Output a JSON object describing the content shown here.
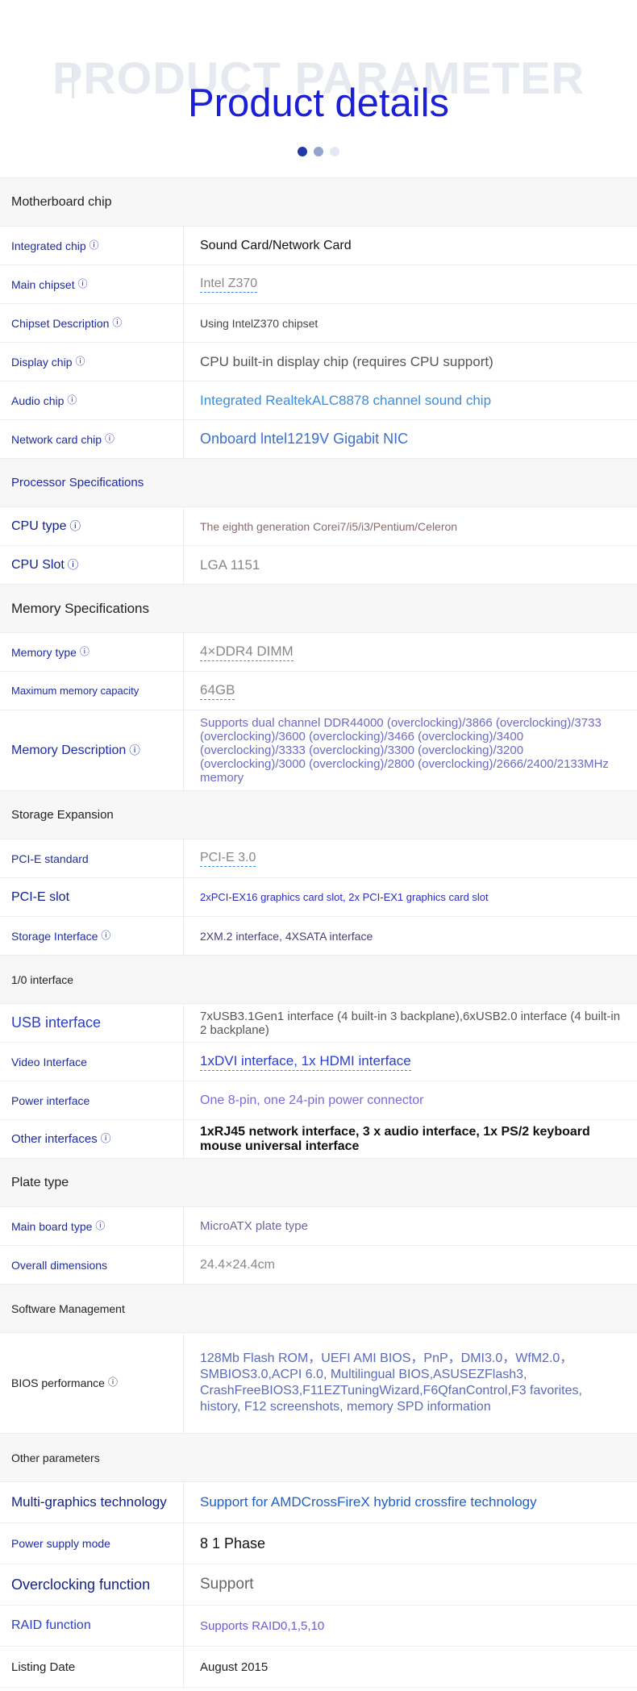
{
  "header": {
    "bg_text": "PRODUCT PARAMETER",
    "title": "Product details"
  },
  "info_symbol": "ⓘ",
  "sections": {
    "motherboard_chip": "Motherboard chip",
    "processor": "Processor Specifications",
    "memory": "Memory Specifications",
    "storage": "Storage Expansion",
    "io": "1/0 interface",
    "plate": "Plate type",
    "software": "Software Management",
    "other": "Other parameters"
  },
  "rows": {
    "integrated_chip": {
      "label": "Integrated chip",
      "value": "Sound Card/Network Card"
    },
    "main_chipset": {
      "label": "Main chipset",
      "value": "Intel Z370"
    },
    "chipset_desc": {
      "label": "Chipset Description",
      "value": "Using IntelZ370 chipset"
    },
    "display_chip": {
      "label": "Display chip",
      "value": "CPU built-in display chip (requires CPU support)"
    },
    "audio_chip": {
      "label": "Audio chip",
      "value": "Integrated RealtekALC8878 channel sound chip"
    },
    "network_chip": {
      "label": "Network card chip",
      "value": "Onboard lntel1219V Gigabit NIC"
    },
    "cpu_type": {
      "label": "CPU type",
      "value": "The eighth generation Corei7/i5/i3/Pentium/Celeron"
    },
    "cpu_slot": {
      "label": "CPU Slot",
      "value": "LGA 1151"
    },
    "memory_type": {
      "label": "Memory type",
      "value": "4×DDR4 DIMM"
    },
    "max_memory": {
      "label": "Maximum memory capacity",
      "value": "64GB"
    },
    "memory_desc": {
      "label": "Memory Description",
      "value": "Supports dual channel DDR44000 (overclocking)/3866 (overclocking)/3733 (overclocking)/3600 (overclocking)/3466 (overclocking)/3400 (overclocking)/3333 (overclocking)/3300 (overclocking)/3200 (overclocking)/3000 (overclocking)/2800 (overclocking)/2666/2400/2133MHz memory"
    },
    "pcie_standard": {
      "label": "PCI-E standard",
      "value": "PCI-E 3.0"
    },
    "pcie_slot": {
      "label": "PCI-E slot",
      "value": "2xPCI-EX16 graphics card slot, 2x PCI-EX1 graphics card slot"
    },
    "storage_interface": {
      "label": "Storage Interface",
      "value": "2XM.2 interface, 4XSATA interface"
    },
    "usb_interface": {
      "label": "USB interface",
      "value": "7xUSB3.1Gen1 interface (4 built-in 3 backplane),6xUSB2.0 interface (4 built-in 2 backplane)"
    },
    "video_interface": {
      "label": "Video Interface",
      "value": "1xDVI interface, 1x HDMI interface"
    },
    "power_interface": {
      "label": "Power interface",
      "value": "One 8-pin, one 24-pin power connector"
    },
    "other_interfaces": {
      "label": "Other interfaces",
      "value": "1xRJ45 network interface, 3 x audio interface, 1x PS/2 keyboard mouse universal interface"
    },
    "board_type": {
      "label": "Main board type",
      "value": "MicroATX plate type"
    },
    "dimensions": {
      "label": "Overall dimensions",
      "value": "24.4×24.4cm"
    },
    "bios": {
      "label": "BIOS performance",
      "value": "128Mb Flash ROM，UEFI AMI BIOS，PnP，DMI3.0，WfM2.0，SMBIOS3.0,ACPI 6.0, Multilingual BIOS,ASUSEZFlash3, CrashFreeBIOS3,F11EZTuningWizard,F6QfanControl,F3 favorites, history, F12 screenshots, memory SPD information"
    },
    "multi_graphics": {
      "label": "Multi-graphics technology",
      "value": "Support for AMDCrossFireX hybrid crossfire technology"
    },
    "power_supply": {
      "label": "Power supply mode",
      "value": "8 1 Phase"
    },
    "overclocking": {
      "label": "Overclocking function",
      "value": "Support"
    },
    "raid": {
      "label": "RAID function",
      "value": "Supports RAID0,1,5,10"
    },
    "listing_date": {
      "label": "Listing Date",
      "value": "August 2015"
    }
  },
  "colors": {
    "title": "#1b1fd6",
    "label": "#1b2aa8",
    "value_blue": "#3b8de0",
    "section_bg": "#f7f7f7"
  }
}
